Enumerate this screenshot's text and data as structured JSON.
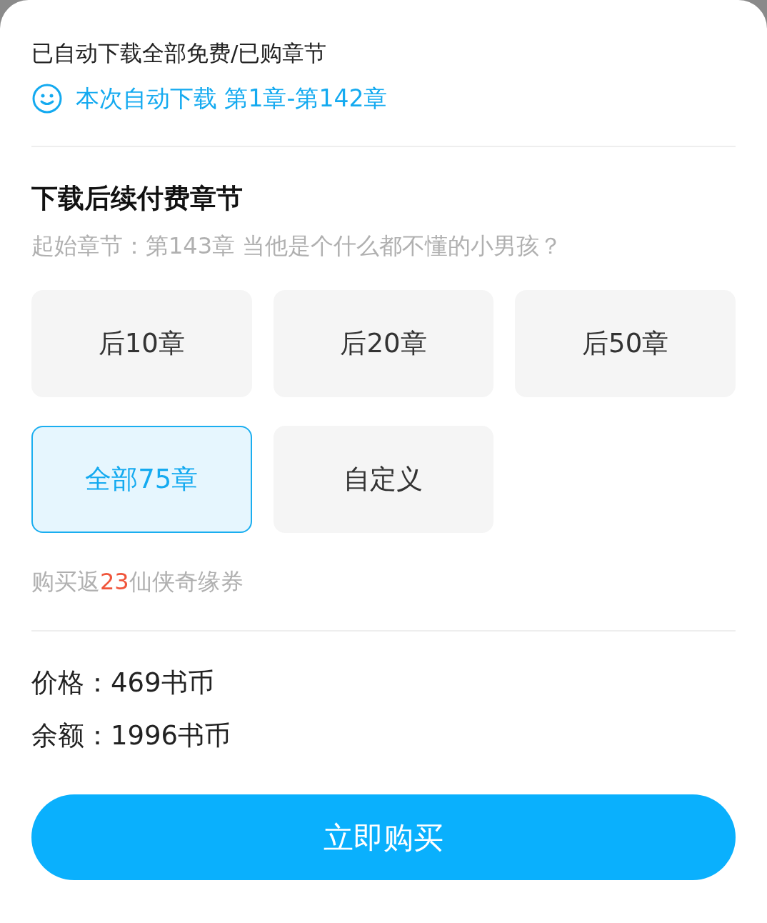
{
  "auto_download": {
    "title": "已自动下载全部免费/已购章节",
    "status": "本次自动下载 第1章-第142章"
  },
  "paid_section": {
    "title": "下载后续付费章节",
    "start_chapter": "起始章节：第143章 当他是个什么都不懂的小男孩？"
  },
  "options": [
    {
      "label": "后10章",
      "selected": false
    },
    {
      "label": "后20章",
      "selected": false
    },
    {
      "label": "后50章",
      "selected": false
    },
    {
      "label": "全部75章",
      "selected": true
    },
    {
      "label": "自定义",
      "selected": false
    }
  ],
  "reward": {
    "prefix": "购买返",
    "amount": "23",
    "suffix": "仙侠奇缘券"
  },
  "price": "价格：469书币",
  "balance": "余额：1996书币",
  "buy_button": "立即购买"
}
